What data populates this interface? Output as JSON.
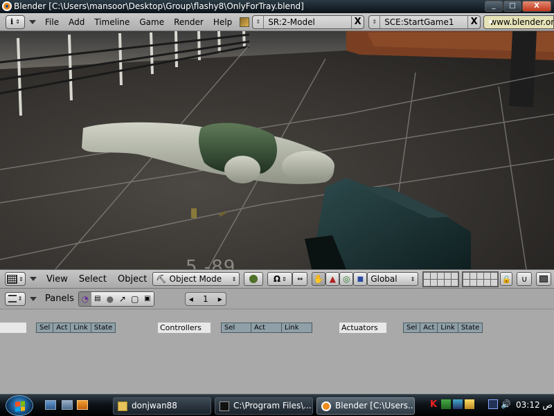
{
  "window": {
    "title": "Blender [C:\\Users\\mansoor\\Desktop\\Group\\flashy8\\OnlyForTray.blend]",
    "minimize": "_",
    "maximize": "□",
    "close": "X"
  },
  "menubar": {
    "items": [
      "File",
      "Add",
      "Timeline",
      "Game",
      "Render",
      "Help"
    ],
    "screen_field": "SR:2-Model",
    "scene_field": "SCE:StartGame1",
    "close_glyph": "X",
    "url": "www.blender.org"
  },
  "viewport": {
    "hud_text": "5 -89"
  },
  "view3d_header": {
    "menus": [
      "View",
      "Select",
      "Object"
    ],
    "mode": "Object Mode",
    "orientation": "Global",
    "pivot_glyph": "Ω"
  },
  "buttons_header": {
    "panels_label": "Panels",
    "page_number": "1",
    "prev": "◂",
    "next": "▸"
  },
  "logic": {
    "sensors_tabs": [
      "Sel",
      "Act",
      "Link",
      "State"
    ],
    "controllers_label": "Controllers",
    "controllers_tabs": [
      "Sel",
      "Act",
      "Link"
    ],
    "actuators_label": "Actuators",
    "actuators_tabs": [
      "Sel",
      "Act",
      "Link",
      "State"
    ]
  },
  "taskbar": {
    "tasks": [
      {
        "label": "donjwan88",
        "icon": "folder-icon"
      },
      {
        "label": "C:\\Program Files\\...",
        "icon": "console-icon"
      },
      {
        "label": "Blender [C:\\Users...",
        "icon": "blender-icon"
      }
    ],
    "clock": "03:12",
    "clock_suffix": "ص"
  }
}
